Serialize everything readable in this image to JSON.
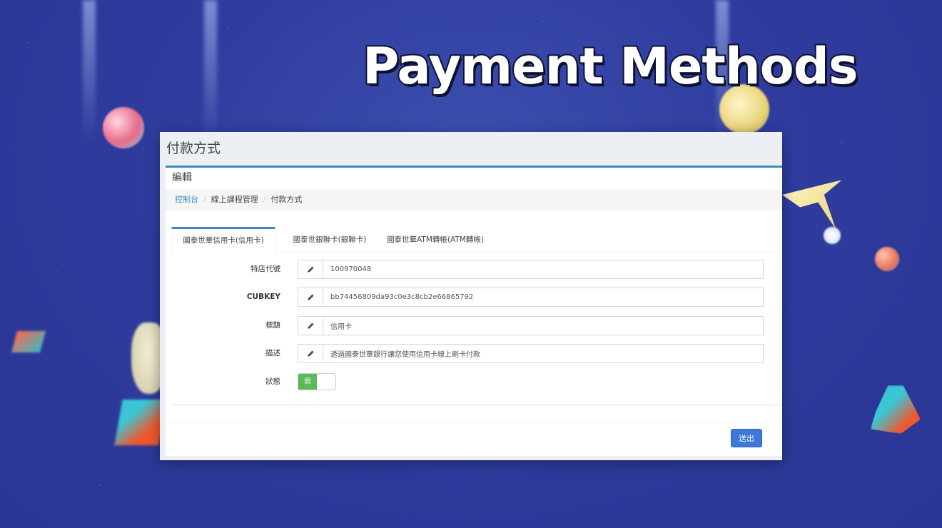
{
  "hero": {
    "title": "Payment Methods"
  },
  "page": {
    "header": "付款方式",
    "box_title": "編輯"
  },
  "breadcrumb": [
    "控制台",
    "線上課程管理",
    "付款方式"
  ],
  "tabs": [
    {
      "label": "國泰世華信用卡(信用卡)",
      "active": true
    },
    {
      "label": "國泰世銀聯卡(銀聯卡)",
      "active": false
    },
    {
      "label": "國泰世華ATM轉帳(ATM轉帳)",
      "active": false
    }
  ],
  "form": {
    "store_code": {
      "label": "特店代號",
      "value": "100970048",
      "icon": "pencil-icon"
    },
    "cubkey": {
      "label": "CUBKEY",
      "value": "bb74456809da93c0e3c8cb2e66865792",
      "icon": "pencil-icon"
    },
    "title": {
      "label": "標題",
      "value": "信用卡",
      "icon": "pencil-icon"
    },
    "description": {
      "label": "描述",
      "value": "透過國泰世華銀行讓您使用信用卡線上刷卡付款",
      "icon": "pencil-icon"
    },
    "status": {
      "label": "狀態",
      "on_label": "開",
      "enabled": true
    }
  },
  "actions": {
    "submit_label": "送出"
  },
  "colors": {
    "primary": "#3c8dbc",
    "button": "#3c78d8",
    "toggle_on": "#5cb85c",
    "background": "#2f3c9e"
  }
}
